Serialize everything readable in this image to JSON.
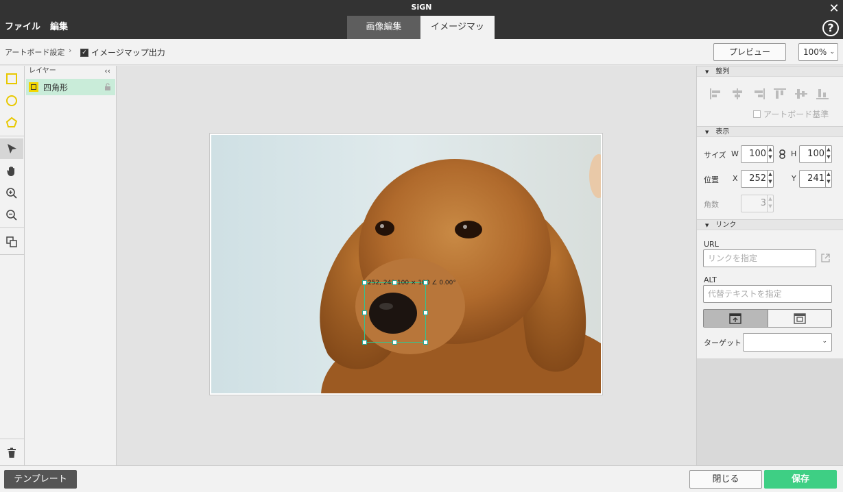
{
  "app": {
    "title": "SiGN"
  },
  "menu": {
    "file": "ファイル",
    "edit": "編集"
  },
  "tabs": [
    {
      "label": "画像編集"
    },
    {
      "label": "イメージマップ"
    }
  ],
  "toolbar": {
    "artboard_settings": "アートボード設定",
    "separator": "›",
    "imagemap_output": "イメージマップ出力",
    "preview": "プレビュー",
    "zoom": "100%"
  },
  "layers": {
    "title": "レイヤー",
    "collapse": "‹‹",
    "items": [
      {
        "name": "四角形"
      }
    ]
  },
  "selection": {
    "label": "252, 241  100 × 100  ∠ 0.00°"
  },
  "panel": {
    "align": {
      "title": "整列",
      "artboard_basis": "アートボード基準"
    },
    "display": {
      "title": "表示",
      "size_label": "サイズ",
      "w_label": "W",
      "w_value": "100",
      "h_label": "H",
      "h_value": "100",
      "pos_label": "位置",
      "x_label": "X",
      "x_value": "252",
      "y_label": "Y",
      "y_value": "241",
      "corners_label": "角数",
      "corners_value": "3"
    },
    "link": {
      "title": "リンク",
      "url_label": "URL",
      "url_placeholder": "リンクを指定",
      "alt_label": "ALT",
      "alt_placeholder": "代替テキストを指定",
      "target_label": "ターゲット"
    }
  },
  "bottom": {
    "template": "テンプレート",
    "close": "閉じる",
    "save": "保存"
  },
  "colors": {
    "accent": "#3ecf84",
    "shape_yellow": "#f2d600",
    "titlebar": "#333333"
  }
}
